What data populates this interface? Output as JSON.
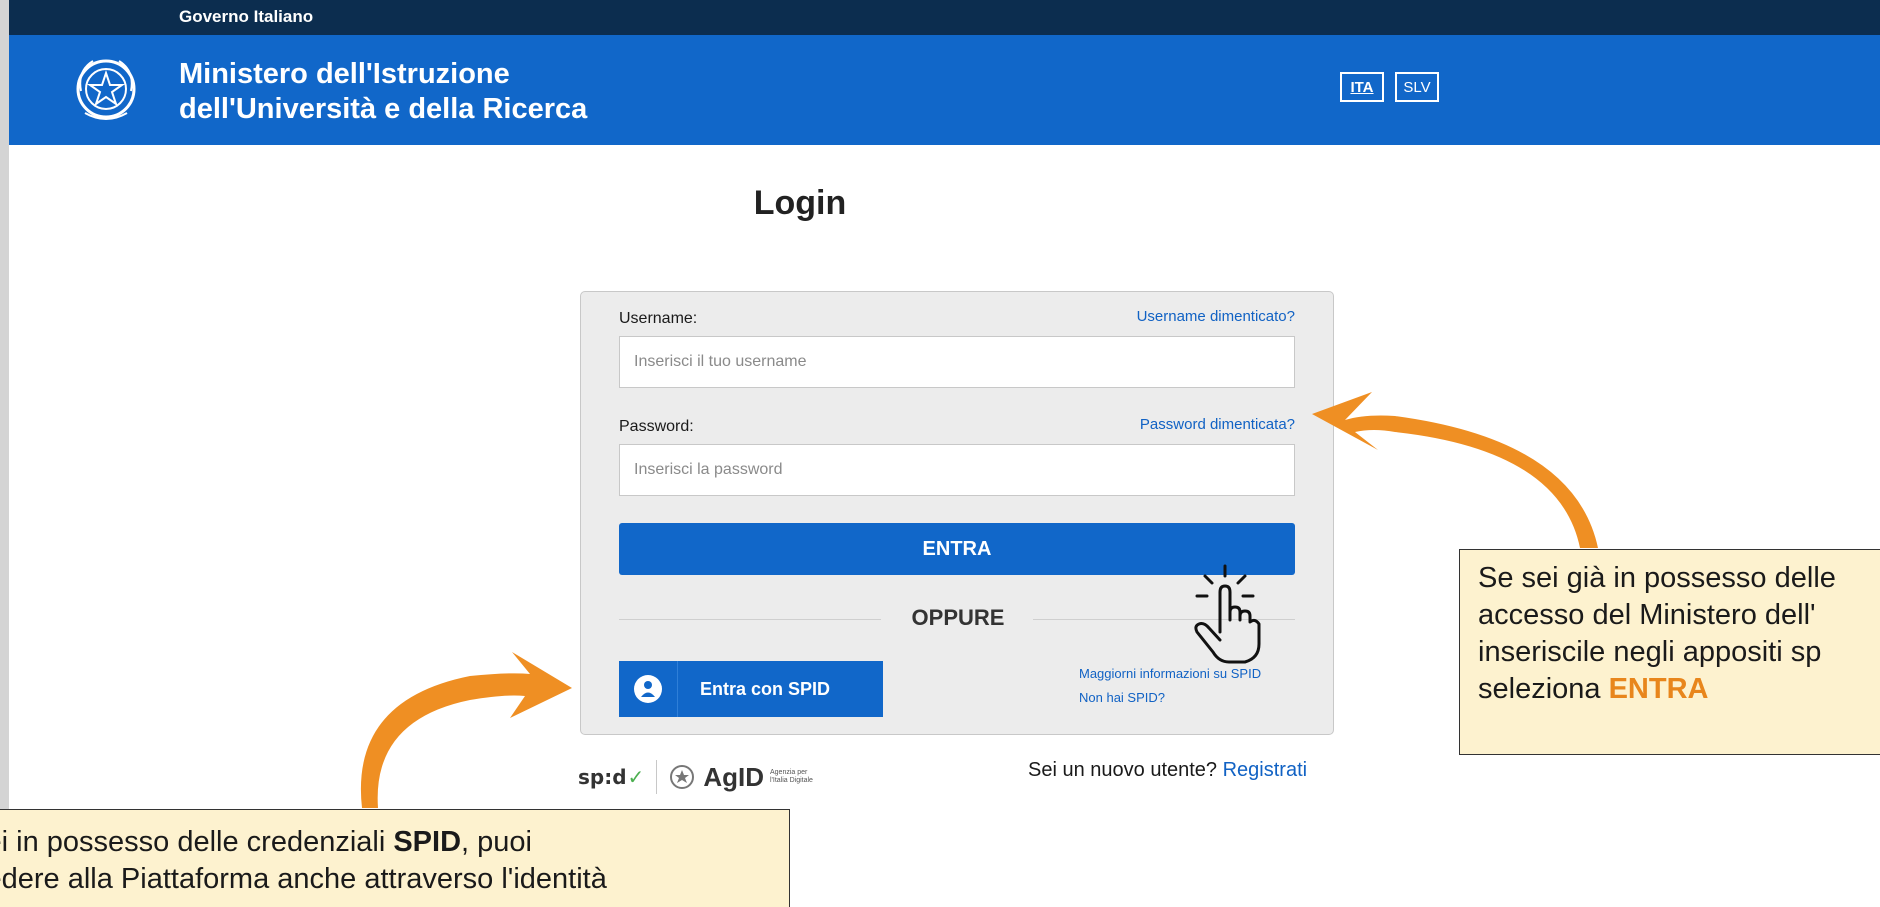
{
  "slim_header": {
    "gov_label": "Governo Italiano"
  },
  "header": {
    "ministry_line1": "Ministero dell'Istruzione",
    "ministry_line2": "dell'Università e della Ricerca",
    "lang_ita": "ITA",
    "lang_slv": "SLV"
  },
  "login": {
    "title": "Login",
    "username_label": "Username:",
    "username_forgot": "Username dimenticato?",
    "username_placeholder": "Inserisci il tuo username",
    "password_label": "Password:",
    "password_forgot": "Password dimenticata?",
    "password_placeholder": "Inserisci la password",
    "submit_label": "ENTRA",
    "or_label": "OPPURE",
    "spid_button": "Entra con SPID",
    "spid_more_info": "Maggiorni informazioni su SPID",
    "spid_no": "Non hai SPID?"
  },
  "footer_logos": {
    "spid": "sp:d",
    "agid": "AgID",
    "agid_sub1": "Agenzia per",
    "agid_sub2": "l'Italia Digitale"
  },
  "register": {
    "question": "Sei un nuovo utente?",
    "link": "Registrati"
  },
  "callouts": {
    "right_line1": "Se sei già in possesso delle",
    "right_line2": "accesso del Ministero dell'",
    "right_line3": "inseriscile negli appositi sp",
    "right_line4_prefix": "seleziona ",
    "right_line4_bold": "ENTRA",
    "left_line1_prefix": " sei in possesso delle credenziali ",
    "left_line1_bold": "SPID",
    "left_line1_suffix": ", puoi",
    "left_line2": "cedere alla Piattaforma anche attraverso l'identità"
  },
  "colors": {
    "brand_blue": "#1167c9",
    "dark_navy": "#0c2d4f",
    "callout_bg": "#fdf2cf",
    "arrow_orange": "#ef8f23"
  }
}
